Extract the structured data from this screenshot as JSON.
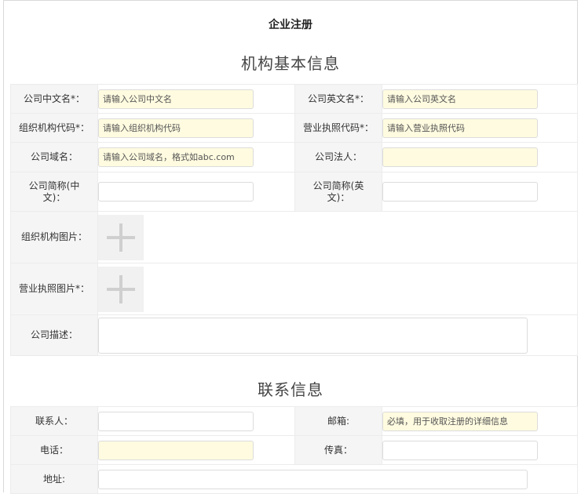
{
  "page": {
    "title": "企业注册"
  },
  "basic": {
    "section_title": "机构基本信息",
    "name_cn": {
      "label": "公司中文名*：",
      "placeholder": "请输入公司中文名"
    },
    "name_en": {
      "label": "公司英文名*：",
      "placeholder": "请输入公司英文名"
    },
    "org_code": {
      "label": "组织机构代码*：",
      "placeholder": "请输入组织机构代码"
    },
    "license_code": {
      "label": "营业执照代码*：",
      "placeholder": "请输入营业执照代码"
    },
    "domain": {
      "label": "公司域名：",
      "placeholder": "请输入公司域名，格式如abc.com"
    },
    "legal_person": {
      "label": "公司法人：",
      "placeholder": ""
    },
    "short_cn": {
      "label": "公司简称(中文)：",
      "placeholder": ""
    },
    "short_en": {
      "label": "公司简称(英文)：",
      "placeholder": ""
    },
    "org_image": {
      "label": "组织机构图片："
    },
    "license_image": {
      "label": "营业执照图片*："
    },
    "description": {
      "label": "公司描述："
    }
  },
  "contact": {
    "section_title": "联系信息",
    "person": {
      "label": "联系人：",
      "placeholder": ""
    },
    "email": {
      "label": "邮箱:",
      "placeholder": "必填，用于收取注册的详细信息"
    },
    "phone": {
      "label": "电话：",
      "placeholder": ""
    },
    "fax": {
      "label": "传真：",
      "placeholder": ""
    },
    "address": {
      "label": "地址:",
      "placeholder": ""
    }
  },
  "colors": {
    "required_bg": "#fffbe0",
    "label_bg": "#f5f5f5",
    "border": "#ececec"
  },
  "icons": {
    "upload": "plus-icon"
  }
}
